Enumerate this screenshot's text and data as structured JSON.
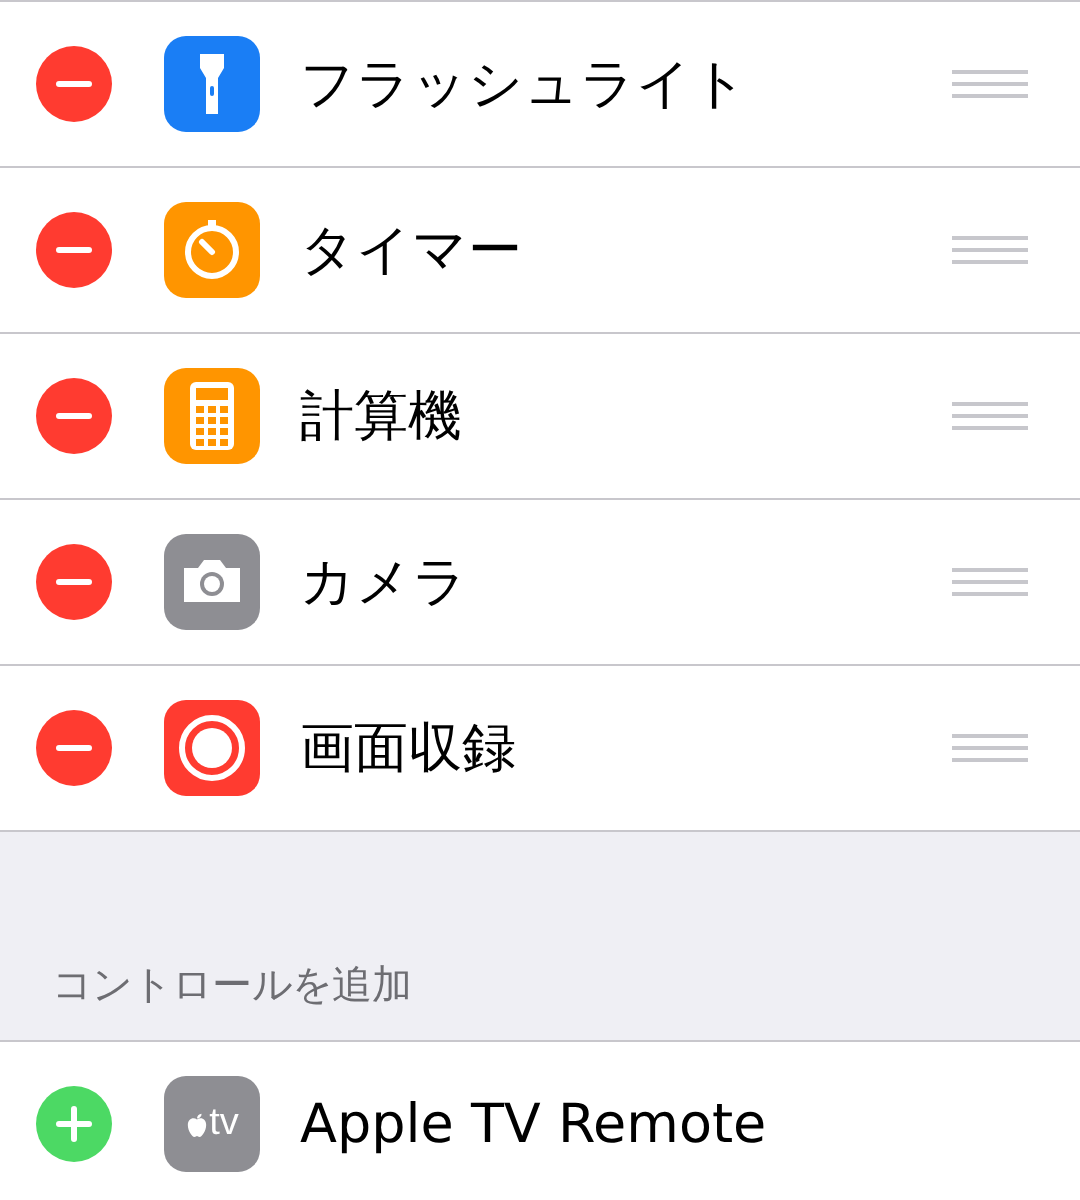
{
  "included": [
    {
      "name": "フラッシュライト",
      "kind": "flashlight",
      "color": "#1a7ef5"
    },
    {
      "name": "タイマー",
      "kind": "timer",
      "color": "#ff9500"
    },
    {
      "name": "計算機",
      "kind": "calculator",
      "color": "#ff9500"
    },
    {
      "name": "カメラ",
      "kind": "camera",
      "color": "#8e8e93"
    },
    {
      "name": "画面収録",
      "kind": "record",
      "color": "#ff3b30"
    }
  ],
  "more_header": "コントロールを追加",
  "more": [
    {
      "name": "Apple TV Remote",
      "kind": "tv",
      "icon_text": "tv",
      "color": "#8e8e93"
    }
  ]
}
